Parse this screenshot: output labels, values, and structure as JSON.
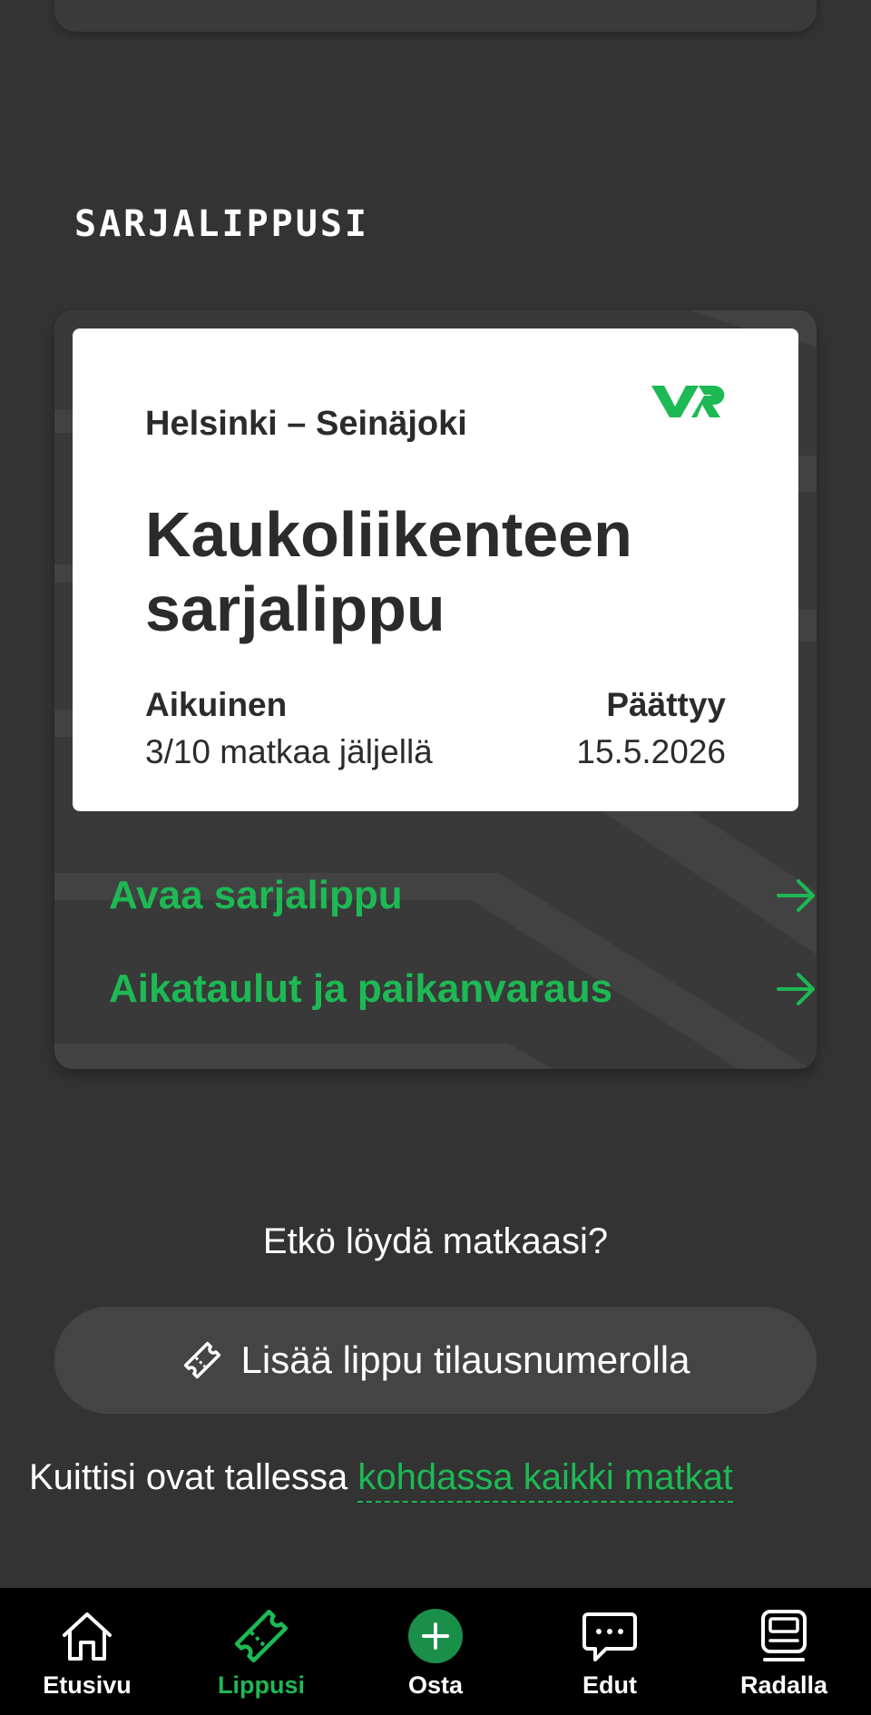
{
  "section": {
    "title": "SARJALIPPUSI"
  },
  "ticket": {
    "route": "Helsinki – Seinäjoki",
    "brand": "VR",
    "name_line1": "Kaukoliikenteen",
    "name_line2": "sarjalippu",
    "passenger_type": "Aikuinen",
    "trips_left": "3/10 matkaa jäljellä",
    "expires_label": "Päättyy",
    "expires_date": "15.5.2026"
  },
  "actions": {
    "open_label": "Avaa sarjalippu",
    "timetables_label": "Aikataulut ja paikanvaraus"
  },
  "not_found": {
    "text": "Etkö löydä matkaasi?"
  },
  "add_ticket": {
    "label": "Lisää lippu tilausnumerolla"
  },
  "receipts": {
    "text": "Kuittisi ovat tallessa",
    "link": "kohdassa kaikki matkat"
  },
  "nav": {
    "items": [
      {
        "label": "Etusivu",
        "icon": "home-icon",
        "active": false
      },
      {
        "label": "Lippusi",
        "icon": "ticket-icon",
        "active": true
      },
      {
        "label": "Osta",
        "icon": "plus-icon",
        "active": false
      },
      {
        "label": "Edut",
        "icon": "chat-icon",
        "active": false
      },
      {
        "label": "Radalla",
        "icon": "train-icon",
        "active": false
      }
    ]
  },
  "colors": {
    "background": "#333333",
    "accent": "#1db954",
    "card": "#393939",
    "ticket": "#ffffff",
    "nav_background": "#000000"
  }
}
